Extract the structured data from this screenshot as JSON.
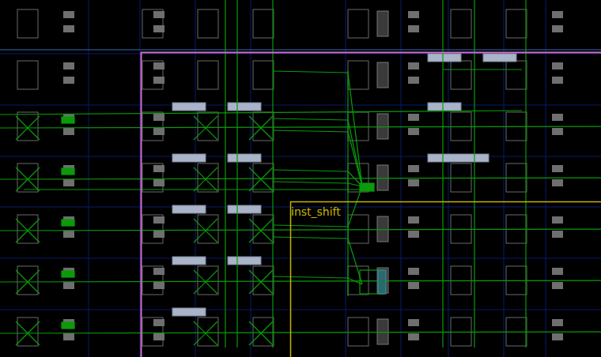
{
  "device_view": {
    "cell_labels": [
      {
        "text": "inst_shift",
        "color": "#c8b400"
      }
    ]
  }
}
